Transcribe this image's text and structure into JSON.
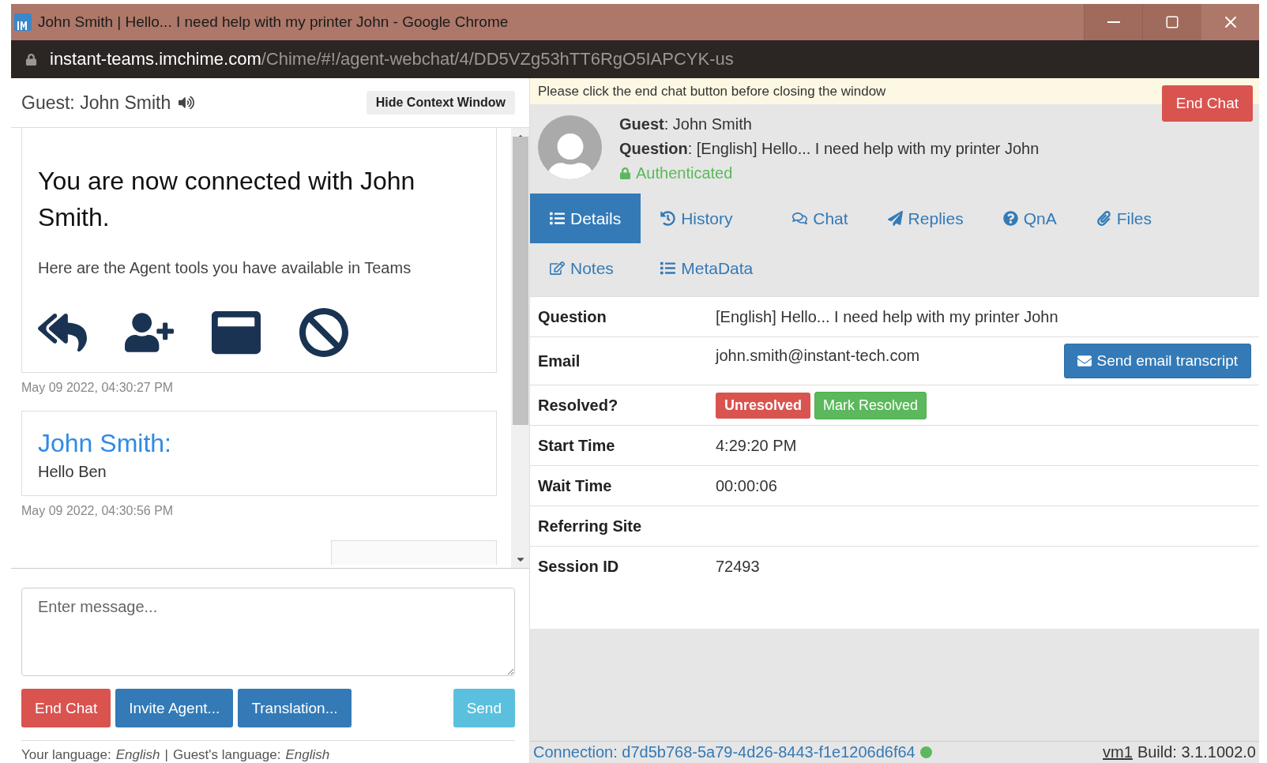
{
  "window": {
    "title": "John Smith | Hello... I need help with my printer John - Google Chrome"
  },
  "address_bar": {
    "host": "instant-teams.imchime.com",
    "path": "/Chime/#!/agent-webchat/4/DD5VZg53hTT6RgO5IAPCYK-us"
  },
  "chat_header": {
    "title": "Guest: John Smith",
    "hide_button": "Hide Context Window"
  },
  "messages": [
    {
      "kind": "system",
      "heading": "You are now connected with John Smith.",
      "text": "Here are the Agent tools you have available in Teams",
      "timestamp": "May 09 2022, 04:30:27 PM"
    },
    {
      "kind": "guest",
      "sender": "John Smith:",
      "text": "Hello Ben",
      "timestamp": "May 09 2022, 04:30:56 PM"
    }
  ],
  "composer": {
    "placeholder": "Enter message...",
    "buttons": [
      {
        "label": "End Chat",
        "kind": "danger"
      },
      {
        "label": "Invite Agent...",
        "kind": "primary"
      },
      {
        "label": "Translation...",
        "kind": "primary"
      }
    ],
    "send": "Send",
    "your_language_label": "Your language:",
    "your_language": "English",
    "separator": "|",
    "guest_language_label": "Guest's language:",
    "guest_language": "English"
  },
  "notice": {
    "text": "Please click the end chat button before closing the window",
    "end_chat": "End Chat"
  },
  "profile": {
    "guest": "**Guest**: John Smith",
    "question": "**Question**: [English] Hello... I need help with my printer John",
    "authenticated": true,
    "auth_label": "Authenticated"
  },
  "tabs": [
    {
      "label": "Details",
      "selected": true
    },
    {
      "label": "History",
      "selected": false
    },
    {
      "label": "Chat",
      "selected": false
    },
    {
      "label": "Replies",
      "selected": false
    },
    {
      "label": "QnA",
      "selected": false
    },
    {
      "label": "Files",
      "selected": false
    },
    {
      "label": "Notes",
      "selected": false
    },
    {
      "label": "MetaData",
      "selected": false
    }
  ],
  "details": [
    {
      "kind": "text",
      "label": "Question",
      "value": "[English] Hello... I need help with my printer John"
    },
    {
      "kind": "email",
      "label": "Email",
      "value": "john.smith@instant-tech.com",
      "button": "Send email transcript"
    },
    {
      "kind": "status",
      "label": "Resolved?",
      "resolved": false,
      "status": "Unresolved",
      "button": "Mark Resolved"
    },
    {
      "kind": "text",
      "label": "Start Time",
      "value": "4:29:20 PM"
    },
    {
      "kind": "text",
      "label": "Wait Time",
      "value": "00:00:06"
    },
    {
      "kind": "text",
      "label": "Referring Site"
    },
    {
      "kind": "text",
      "label": "Session ID",
      "value": "72493"
    }
  ],
  "footer": {
    "connection": "Connection: d7d5b768-5a79-4d26-8443-f1e1206d6f64",
    "connected": true,
    "vm": "vm1",
    "build": "Build: 3.1.1002.0"
  }
}
